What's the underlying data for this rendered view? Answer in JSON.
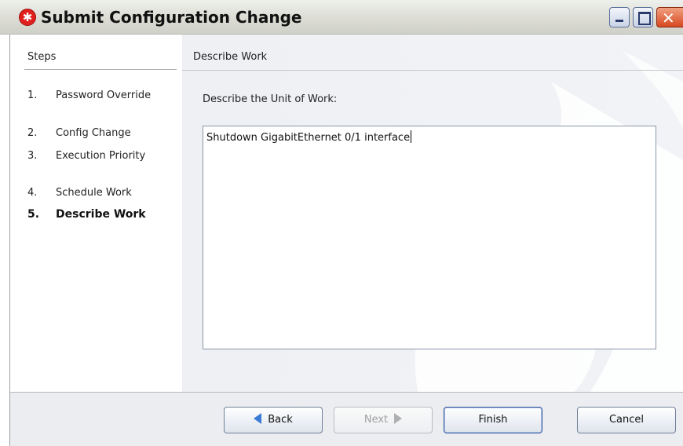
{
  "window": {
    "title": "Submit Configuration Change",
    "icon": "red-asterisk-icon",
    "controls": [
      "minimize-icon",
      "maximize-icon",
      "close-icon"
    ]
  },
  "steps": {
    "header": "Steps",
    "items": [
      {
        "number": "1.",
        "label": "Password Override",
        "active": false
      },
      {
        "number": "2.",
        "label": "Config Change",
        "active": false
      },
      {
        "number": "3.",
        "label": "Execution Priority",
        "active": false
      },
      {
        "number": "4.",
        "label": "Schedule Work",
        "active": false
      },
      {
        "number": "5.",
        "label": "Describe Work",
        "active": true
      }
    ]
  },
  "panel": {
    "title": "Describe Work",
    "prompt": "Describe the Unit of Work:",
    "description_value": "Shutdown GigabitEthernet 0/1 interface"
  },
  "buttons": {
    "back": "Back",
    "next": "Next",
    "finish": "Finish",
    "cancel": "Cancel"
  },
  "colors": {
    "title_bar": "#dcdcd4",
    "content_bg": "#eef0f4",
    "accent_arrow": "#3a7bd5",
    "close_button": "#d84820"
  }
}
